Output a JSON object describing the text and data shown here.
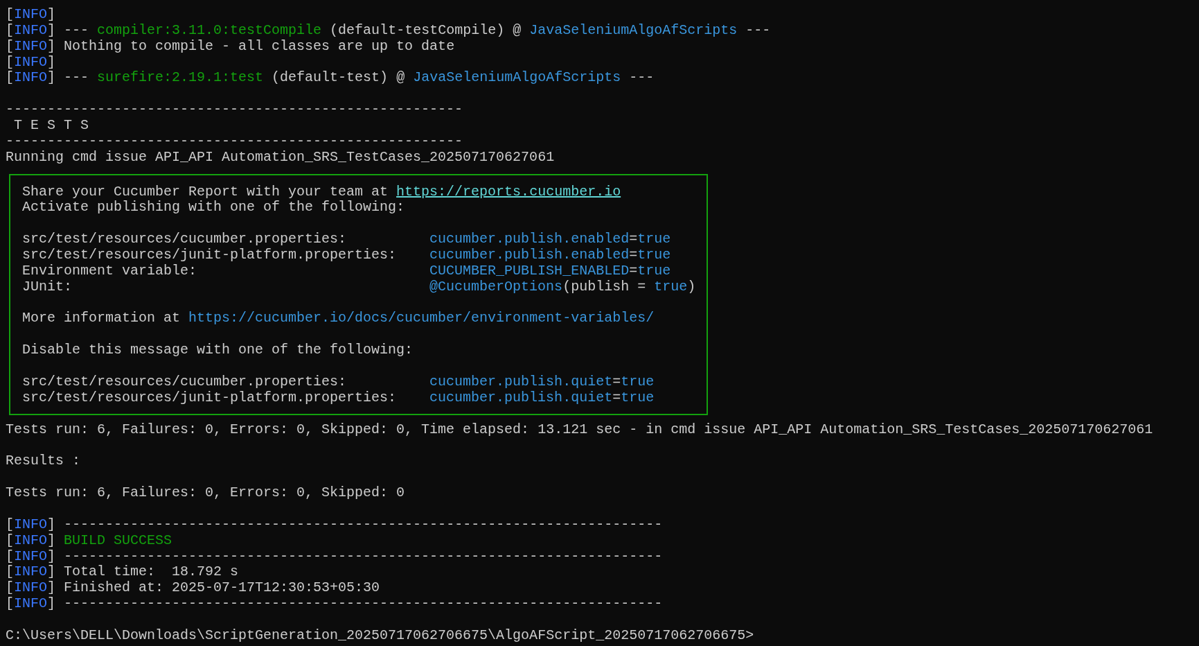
{
  "console": {
    "before": [
      {
        "kind": "text",
        "segments": [
          {
            "kind": "plain",
            "text": "["
          },
          {
            "kind": "info",
            "text": "INFO"
          },
          {
            "kind": "plain",
            "text": "]"
          }
        ]
      },
      {
        "kind": "text",
        "segments": [
          {
            "kind": "plain",
            "text": "["
          },
          {
            "kind": "info",
            "text": "INFO"
          },
          {
            "kind": "plain",
            "text": "] --- "
          },
          {
            "kind": "green",
            "text": "compiler:3.11.0:testCompile"
          },
          {
            "kind": "plain",
            "text": " (default-testCompile) @ "
          },
          {
            "kind": "blue",
            "text": "JavaSeleniumAlgoAfScripts"
          },
          {
            "kind": "plain",
            "text": " ---"
          }
        ]
      },
      {
        "kind": "text",
        "segments": [
          {
            "kind": "plain",
            "text": "["
          },
          {
            "kind": "info",
            "text": "INFO"
          },
          {
            "kind": "plain",
            "text": "] Nothing to compile - all classes are up to date"
          }
        ]
      },
      {
        "kind": "text",
        "segments": [
          {
            "kind": "plain",
            "text": "["
          },
          {
            "kind": "info",
            "text": "INFO"
          },
          {
            "kind": "plain",
            "text": "]"
          }
        ]
      },
      {
        "kind": "text",
        "segments": [
          {
            "kind": "plain",
            "text": "["
          },
          {
            "kind": "info",
            "text": "INFO"
          },
          {
            "kind": "plain",
            "text": "] --- "
          },
          {
            "kind": "green",
            "text": "surefire:2.19.1:test"
          },
          {
            "kind": "plain",
            "text": " (default-test) @ "
          },
          {
            "kind": "blue",
            "text": "JavaSeleniumAlgoAfScripts"
          },
          {
            "kind": "plain",
            "text": " ---"
          }
        ]
      },
      {
        "kind": "blank"
      },
      {
        "kind": "text",
        "segments": [
          {
            "kind": "plain",
            "text": "-------------------------------------------------------"
          }
        ]
      },
      {
        "kind": "text",
        "segments": [
          {
            "kind": "plain",
            "text": " T E S T S"
          }
        ]
      },
      {
        "kind": "text",
        "segments": [
          {
            "kind": "plain",
            "text": "-------------------------------------------------------"
          }
        ]
      },
      {
        "kind": "text",
        "segments": [
          {
            "kind": "plain",
            "text": "Running cmd issue API_API Automation_SRS_TestCases_202507170627061"
          }
        ]
      }
    ],
    "notice_box": [
      {
        "kind": "text",
        "segments": [
          {
            "kind": "plain",
            "text": "Share your Cucumber Report with your team at "
          },
          {
            "kind": "link",
            "text": "https://reports.cucumber.io"
          }
        ]
      },
      {
        "kind": "text",
        "segments": [
          {
            "kind": "plain",
            "text": "Activate publishing with one of the following:"
          }
        ]
      },
      {
        "kind": "blank"
      },
      {
        "kind": "pair",
        "key": "src/test/resources/cucumber.properties:",
        "segments": [
          {
            "kind": "blue",
            "text": "cucumber.publish.enabled"
          },
          {
            "kind": "plain",
            "text": "="
          },
          {
            "kind": "blue",
            "text": "true"
          }
        ]
      },
      {
        "kind": "pair",
        "key": "src/test/resources/junit-platform.properties:",
        "segments": [
          {
            "kind": "blue",
            "text": "cucumber.publish.enabled"
          },
          {
            "kind": "plain",
            "text": "="
          },
          {
            "kind": "blue",
            "text": "true"
          }
        ]
      },
      {
        "kind": "pair",
        "key": "Environment variable:",
        "segments": [
          {
            "kind": "blue",
            "text": "CUCUMBER_PUBLISH_ENABLED"
          },
          {
            "kind": "plain",
            "text": "="
          },
          {
            "kind": "blue",
            "text": "true"
          }
        ]
      },
      {
        "kind": "pair",
        "key": "JUnit:",
        "segments": [
          {
            "kind": "blue",
            "text": "@CucumberOptions"
          },
          {
            "kind": "plain",
            "text": "(publish = "
          },
          {
            "kind": "blue",
            "text": "true"
          },
          {
            "kind": "plain",
            "text": ")"
          }
        ]
      },
      {
        "kind": "blank"
      },
      {
        "kind": "text",
        "segments": [
          {
            "kind": "plain",
            "text": "More information at "
          },
          {
            "kind": "blue",
            "text": "https://cucumber.io/docs/cucumber/environment-variables/"
          }
        ]
      },
      {
        "kind": "blank"
      },
      {
        "kind": "text",
        "segments": [
          {
            "kind": "plain",
            "text": "Disable this message with one of the following:"
          }
        ]
      },
      {
        "kind": "blank"
      },
      {
        "kind": "pair",
        "key": "src/test/resources/cucumber.properties:",
        "segments": [
          {
            "kind": "blue",
            "text": "cucumber.publish.quiet"
          },
          {
            "kind": "plain",
            "text": "="
          },
          {
            "kind": "blue",
            "text": "true"
          }
        ]
      },
      {
        "kind": "pair",
        "key": "src/test/resources/junit-platform.properties:",
        "segments": [
          {
            "kind": "blue",
            "text": "cucumber.publish.quiet"
          },
          {
            "kind": "plain",
            "text": "="
          },
          {
            "kind": "blue",
            "text": "true"
          }
        ]
      }
    ],
    "after": [
      {
        "kind": "text",
        "segments": [
          {
            "kind": "plain",
            "text": "Tests run: 6, Failures: 0, Errors: 0, Skipped: 0, Time elapsed: 13.121 sec - in cmd issue API_API Automation_SRS_TestCases_202507170627061"
          }
        ]
      },
      {
        "kind": "blank"
      },
      {
        "kind": "text",
        "segments": [
          {
            "kind": "plain",
            "text": "Results :"
          }
        ]
      },
      {
        "kind": "blank"
      },
      {
        "kind": "text",
        "segments": [
          {
            "kind": "plain",
            "text": "Tests run: 6, Failures: 0, Errors: 0, Skipped: 0"
          }
        ]
      },
      {
        "kind": "blank"
      },
      {
        "kind": "text",
        "segments": [
          {
            "kind": "plain",
            "text": "["
          },
          {
            "kind": "info",
            "text": "INFO"
          },
          {
            "kind": "plain",
            "text": "] ------------------------------------------------------------------------"
          }
        ]
      },
      {
        "kind": "text",
        "segments": [
          {
            "kind": "plain",
            "text": "["
          },
          {
            "kind": "info",
            "text": "INFO"
          },
          {
            "kind": "plain",
            "text": "] "
          },
          {
            "kind": "green",
            "text": "BUILD SUCCESS"
          }
        ]
      },
      {
        "kind": "text",
        "segments": [
          {
            "kind": "plain",
            "text": "["
          },
          {
            "kind": "info",
            "text": "INFO"
          },
          {
            "kind": "plain",
            "text": "] ------------------------------------------------------------------------"
          }
        ]
      },
      {
        "kind": "text",
        "segments": [
          {
            "kind": "plain",
            "text": "["
          },
          {
            "kind": "info",
            "text": "INFO"
          },
          {
            "kind": "plain",
            "text": "] Total time:  18.792 s"
          }
        ]
      },
      {
        "kind": "text",
        "segments": [
          {
            "kind": "plain",
            "text": "["
          },
          {
            "kind": "info",
            "text": "INFO"
          },
          {
            "kind": "plain",
            "text": "] Finished at: 2025-07-17T12:30:53+05:30"
          }
        ]
      },
      {
        "kind": "text",
        "segments": [
          {
            "kind": "plain",
            "text": "["
          },
          {
            "kind": "info",
            "text": "INFO"
          },
          {
            "kind": "plain",
            "text": "] ------------------------------------------------------------------------"
          }
        ]
      },
      {
        "kind": "blank"
      },
      {
        "kind": "prompt",
        "segments": [
          {
            "kind": "plain",
            "text": "C:\\Users\\DELL\\Downloads\\ScriptGeneration_20250717062706675\\AlgoAFScript_20250717062706675>"
          }
        ]
      }
    ]
  }
}
